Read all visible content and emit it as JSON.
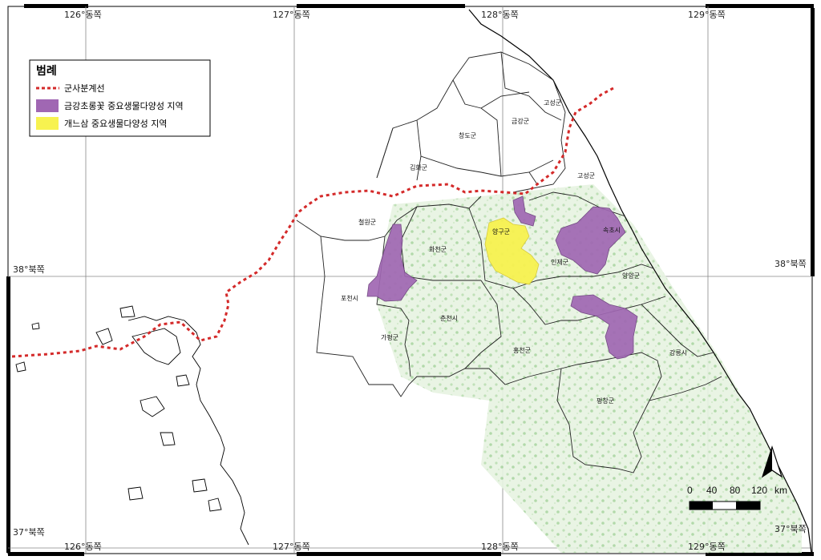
{
  "coords": {
    "top": [
      "126°동쪽",
      "127°동쪽",
      "128°동쪽",
      "129°동쪽"
    ],
    "bottom": [
      "126°동쪽",
      "127°동쪽",
      "128°동쪽",
      "129°동쪽"
    ],
    "left": [
      "38°북쪽",
      "37°북쪽"
    ],
    "right": [
      "38°북쪽",
      "37°북쪽"
    ],
    "top_corner": "38°북쪽"
  },
  "legend": {
    "title": "범례",
    "items": [
      {
        "label": "군사분계선",
        "symbol": "dashed-line",
        "color": "#d42a2a"
      },
      {
        "label": "금강초롱꽃 중요생물다양성 지역",
        "symbol": "fill",
        "color": "#a067b3"
      },
      {
        "label": "개느삼 중요생물다양성 지역",
        "symbol": "fill",
        "color": "#f7f250"
      }
    ]
  },
  "regions": {
    "goseong_n": "고성군",
    "geumgang": "금강군",
    "changdo": "창도군",
    "gimhwa": "김화군",
    "goseong_s": "고성군",
    "cheorwon": "철원군",
    "hwacheon": "화천군",
    "yanggu": "양구군",
    "sokcho": "속초시",
    "inje": "인제군",
    "yangyang": "양양군",
    "pocheon": "포천시",
    "gapyeong": "가평군",
    "chuncheon": "춘천시",
    "hongcheon": "홍천군",
    "gangneung": "강릉시",
    "pyeongchang": "평창군"
  },
  "scale": {
    "ticks": [
      "0",
      "40",
      "80",
      "120"
    ],
    "unit": "km"
  },
  "north_arrow": "north-arrow-icon",
  "colors": {
    "dmz_line": "#d42a2a",
    "purple_area": "#a067b3",
    "yellow_area": "#f7f250",
    "terrain": "#c9e6c0"
  }
}
